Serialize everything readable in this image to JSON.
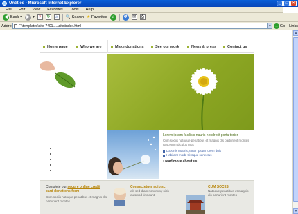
{
  "window": {
    "title": "Untitled - Microsoft Internet Explorer"
  },
  "menu": [
    "File",
    "Edit",
    "View",
    "Favorites",
    "Tools",
    "Help"
  ],
  "toolbar": {
    "back": "Back",
    "search": "Search",
    "favorites": "Favorites"
  },
  "address": {
    "label": "Address",
    "value": "F:\\templates\\site-7401.....\\site\\index.html",
    "go": "Go",
    "links": "Links"
  },
  "nav": [
    "Home page",
    "Who we are",
    "Make donations",
    "See our work",
    "News & press",
    "Contact us"
  ],
  "mid": {
    "lead": "Lorem ipsum facilisis nauris hendrerit porta tortor",
    "body": "Cum sociis natoque penatibus et magnis dis parturient montes nascetur ridiculus mus",
    "link1": "Lobortis mauris, tortor ipsum lorem duis",
    "link2": "Habitant morbi tristique senectus",
    "readmore": "read more about us"
  },
  "bottom": {
    "col1_pre": "Complete our",
    "col1_link": "secure online credit card donations form",
    "col1_body": "Cum sociis natoque penatibus et magnis dis parturient montes",
    "col2_head": "Consectetuer adipisc",
    "col2_body": "elit sed diam nonummy nibh euismod tincidunt",
    "col3_head": "CUM SOCIIS",
    "col3_body": "Natoque penatibus et magnis dis parturient montes"
  }
}
